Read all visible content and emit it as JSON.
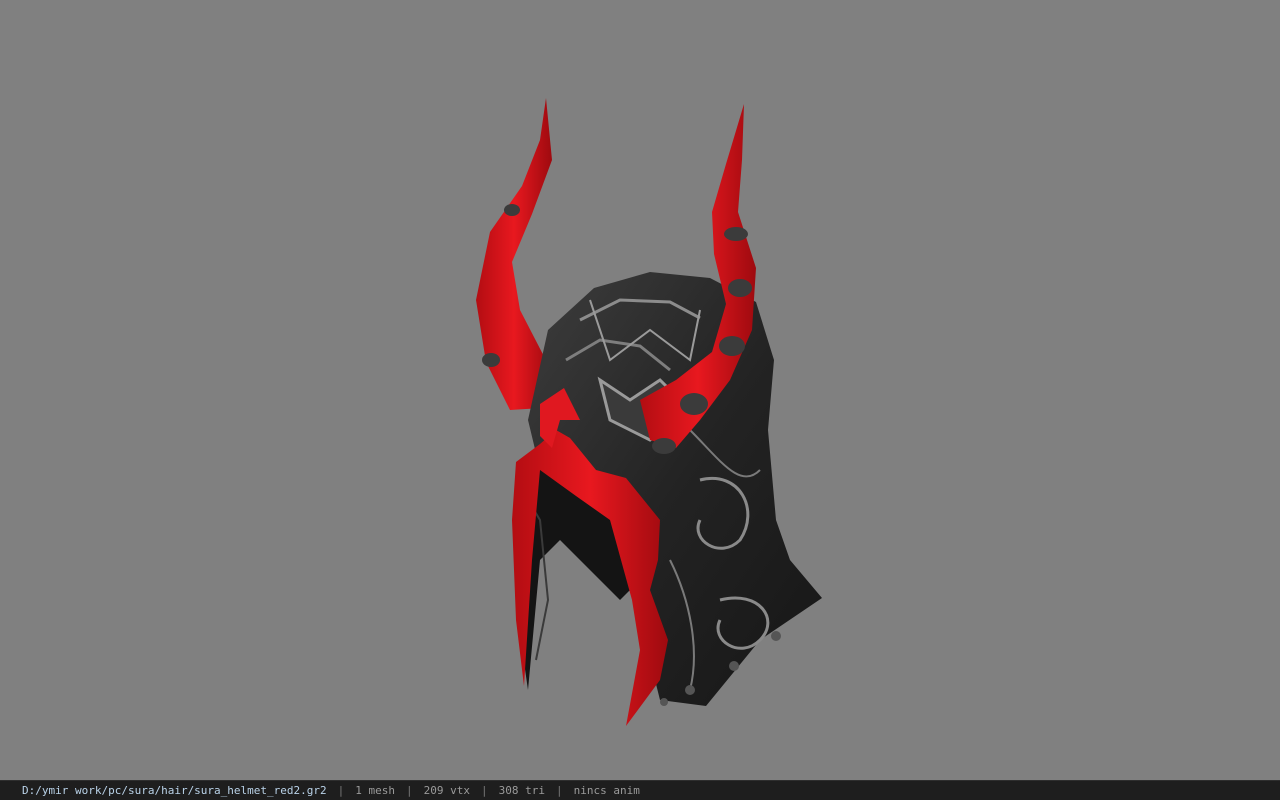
{
  "viewport": {
    "background": "#808080",
    "model": {
      "kind": "helmet-model",
      "accent_color": "#e0161c",
      "metal_color": "#2a2a2a"
    }
  },
  "status": {
    "path": "D:/ymir work/pc/sura/hair/sura_helmet_red2.gr2",
    "mesh": "1 mesh",
    "vtx": "209 vtx",
    "tri": "308 tri",
    "anim": "nincs anim",
    "separator": "|"
  }
}
